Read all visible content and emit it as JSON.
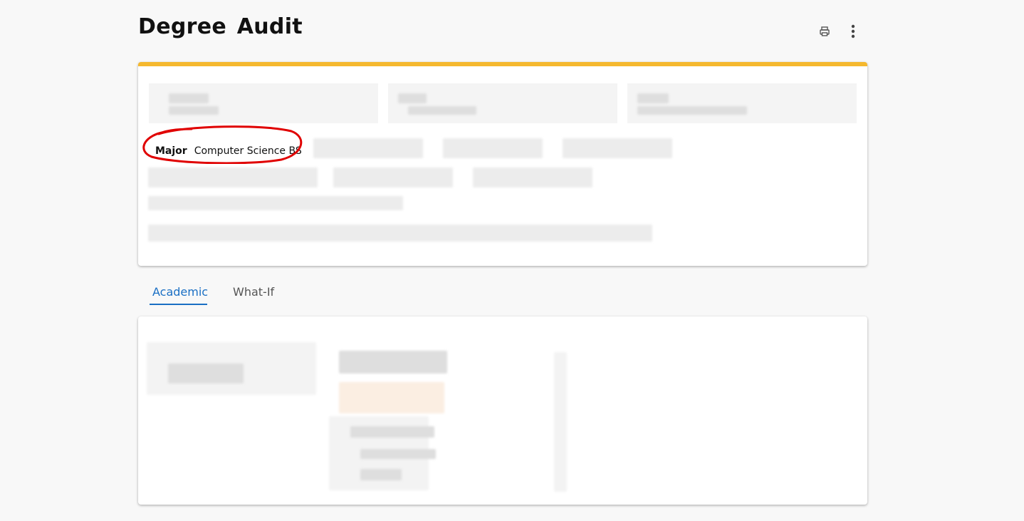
{
  "page": {
    "title": "Degree Audit"
  },
  "toolbar": {
    "print_icon": "printer-icon",
    "more_icon": "more-vertical-icon"
  },
  "header_card": {
    "accent_color": "#f5b82e",
    "major": {
      "label": "Major",
      "value": "Computer Science BS"
    },
    "annotation": {
      "shape": "hand-drawn circle",
      "color": "#e00000"
    }
  },
  "tabs": [
    {
      "label": "Academic",
      "active": true
    },
    {
      "label": "What-If",
      "active": false
    }
  ],
  "colors": {
    "tab_active": "#1a6fc4"
  }
}
